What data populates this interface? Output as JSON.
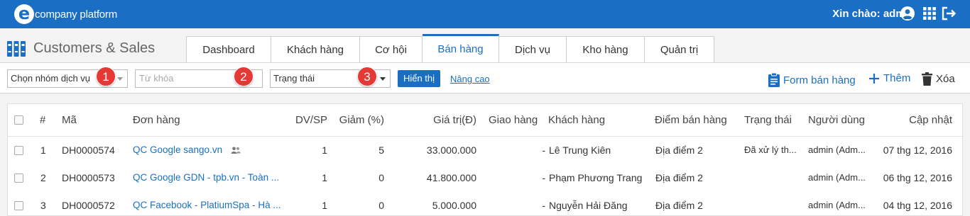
{
  "topbar": {
    "logo_text": "company platform",
    "logo_letter": "e",
    "greeting": "Xin chào: admin"
  },
  "module": {
    "title": "Customers & Sales"
  },
  "tabs": [
    {
      "label": "Dashboard",
      "active": false
    },
    {
      "label": "Khách hàng",
      "active": false
    },
    {
      "label": "Cơ hội",
      "active": false
    },
    {
      "label": "Bán hàng",
      "active": true
    },
    {
      "label": "Dịch vụ",
      "active": false
    },
    {
      "label": "Kho hàng",
      "active": false
    },
    {
      "label": "Quản trị",
      "active": false
    }
  ],
  "filters": {
    "service_group": "Chọn nhóm dịch vụ",
    "keyword_placeholder": "Từ khóa",
    "status": "Trạng thái",
    "show_button": "Hiển thị",
    "advanced_link": "Nâng cao",
    "badges": [
      "1",
      "2",
      "3"
    ]
  },
  "actions": {
    "sales_form": "Form bán hàng",
    "add": "Thêm",
    "delete": "Xóa"
  },
  "table": {
    "headers": {
      "index": "#",
      "code": "Mã",
      "order": "Đơn hàng",
      "items": "DV/SP",
      "discount": "Giảm (%)",
      "value": "Giá trị(Đ)",
      "delivery": "Giao hàng",
      "customer": "Khách hàng",
      "point_of_sale": "Điểm bán hàng",
      "status": "Trạng thái",
      "user": "Người dùng",
      "updated": "Cập nhật"
    },
    "rows": [
      {
        "index": "1",
        "code": "DH0000574",
        "order": "QC Google sango.vn",
        "items": "1",
        "discount": "5",
        "value": "33.000.000",
        "delivery": "-",
        "customer": "Lê Trung Kiên",
        "point_of_sale": "Địa điểm 2",
        "status": "Đã xử lý th...",
        "user": "admin (Adm...",
        "updated": "07 thg 12, 2016"
      },
      {
        "index": "2",
        "code": "DH0000573",
        "order": "QC Google GDN - tpb.vn - Toàn ...",
        "items": "1",
        "discount": "0",
        "value": "41.800.000",
        "delivery": "-",
        "customer": "Phạm Phương Trang",
        "point_of_sale": "Địa điểm 2",
        "status": "",
        "user": "admin (Adm...",
        "updated": "06 thg 12, 2016"
      },
      {
        "index": "3",
        "code": "DH0000572",
        "order": "QC Facebook - PlatiumSpa - Hà ...",
        "items": "1",
        "discount": "0",
        "value": "5.000.000",
        "delivery": "-",
        "customer": "Nguyễn Hải Đăng",
        "point_of_sale": "Địa điểm 2",
        "status": "",
        "user": "admin (Adm...",
        "updated": "04 thg 12, 2016"
      }
    ]
  },
  "colors": {
    "brand": "#1a6fc4",
    "badge": "#e53935"
  }
}
